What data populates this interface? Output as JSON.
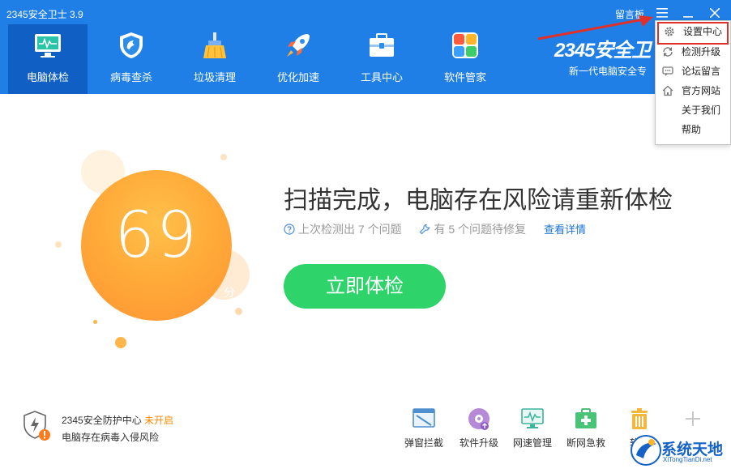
{
  "window": {
    "title": "2345安全卫士 3.9",
    "feedback_label": "留言板",
    "menu_icon": "menu-icon",
    "minimize_icon": "minimize-icon",
    "close_icon": "close-icon"
  },
  "nav": {
    "items": [
      {
        "label": "电脑体检",
        "icon": "monitor-icon",
        "active": true
      },
      {
        "label": "病毒查杀",
        "icon": "shield-icon",
        "active": false
      },
      {
        "label": "垃圾清理",
        "icon": "broom-icon",
        "active": false
      },
      {
        "label": "优化加速",
        "icon": "rocket-icon",
        "active": false
      },
      {
        "label": "工具中心",
        "icon": "toolbox-icon",
        "active": false
      },
      {
        "label": "软件管家",
        "icon": "apps-icon",
        "active": false
      }
    ]
  },
  "brand": {
    "name": "2345安全卫",
    "slogan": "新一代电脑安全专"
  },
  "dropdown": {
    "items": [
      {
        "label": "设置中心",
        "icon": "gear-icon",
        "highlighted": true
      },
      {
        "label": "检测升级",
        "icon": "refresh-icon"
      },
      {
        "label": "论坛留言",
        "icon": "chat-icon"
      },
      {
        "label": "官方网站",
        "icon": "home-icon"
      },
      {
        "label": "关于我们",
        "icon": ""
      },
      {
        "label": "帮助",
        "icon": ""
      }
    ]
  },
  "score": {
    "value": "69",
    "unit": "分"
  },
  "status": {
    "title": "扫描完成，电脑存在风险请重新体检",
    "issues_found": "上次检测出 7 个问题",
    "issues_pending": "有 5 个问题待修复",
    "details_link": "查看详情"
  },
  "scan_button": {
    "label": "立即体检"
  },
  "protection": {
    "name": "2345安全防护中心",
    "state": "未开启",
    "warning": "电脑存在病毒入侵风险"
  },
  "tools": [
    {
      "label": "弹窗拦截",
      "icon": "popup-block-icon"
    },
    {
      "label": "软件升级",
      "icon": "software-upgrade-icon"
    },
    {
      "label": "网速管理",
      "icon": "network-speed-icon"
    },
    {
      "label": "断网急救",
      "icon": "network-rescue-icon"
    },
    {
      "label": "软件",
      "icon": "trash-icon"
    },
    {
      "label": "",
      "icon": "add-icon"
    }
  ],
  "watermark": {
    "title": "系统天地",
    "url": "XiTongTianDi.net"
  },
  "colors": {
    "header_blue": "#1f7fe6",
    "active_tab": "#0f5fc4",
    "orb_orange": "#ffab3a",
    "scan_green": "#2ed36a",
    "warning_orange": "#ff8a00",
    "annotation_red": "#e0302a"
  }
}
